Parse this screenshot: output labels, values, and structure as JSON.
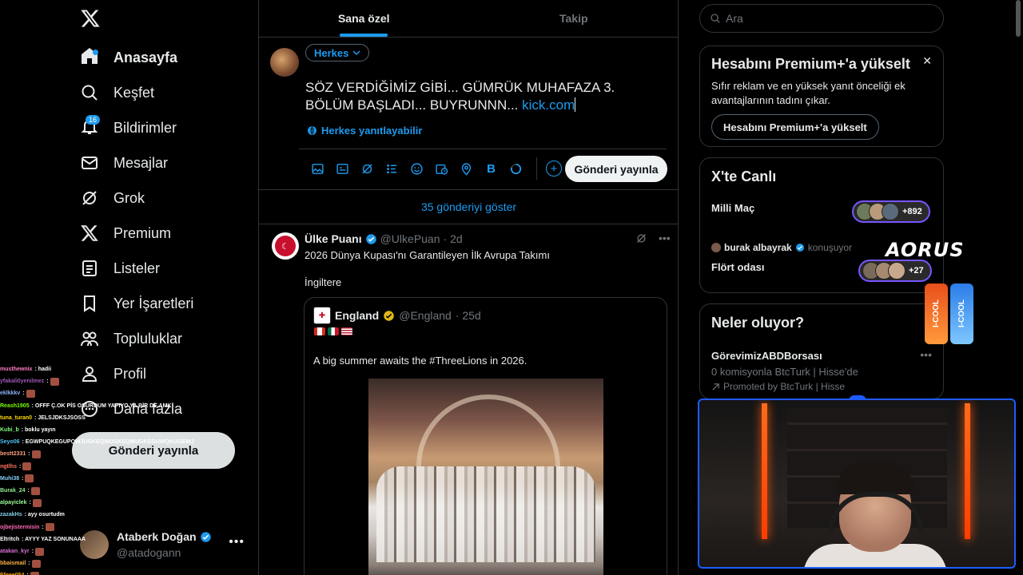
{
  "nav": {
    "items": [
      {
        "label": "Anasayfa",
        "icon": "home-icon"
      },
      {
        "label": "Keşfet",
        "icon": "search-icon"
      },
      {
        "label": "Bildirimler",
        "icon": "bell-icon",
        "badge": "16"
      },
      {
        "label": "Mesajlar",
        "icon": "mail-icon"
      },
      {
        "label": "Grok",
        "icon": "grok-icon"
      },
      {
        "label": "Premium",
        "icon": "x-icon"
      },
      {
        "label": "Listeler",
        "icon": "list-icon"
      },
      {
        "label": "Yer İşaretleri",
        "icon": "bookmark-icon"
      },
      {
        "label": "Topluluklar",
        "icon": "people-icon"
      },
      {
        "label": "Profil",
        "icon": "user-icon"
      },
      {
        "label": "Daha fazla",
        "icon": "more-icon"
      }
    ],
    "post_button": "Gönderi yayınla",
    "account": {
      "name": "Ataberk Doğan",
      "handle": "@atadogann",
      "more": "•••"
    }
  },
  "chat": [
    {
      "user": "musthewnix",
      "msg": ": hadii",
      "color": "#ff7fbf"
    },
    {
      "user": "yfakali0yenilmez",
      "msg": ":",
      "color": "#9b59b6"
    },
    {
      "user": "eklkkkv",
      "msg": ":",
      "color": "#8ab4f8"
    },
    {
      "user": "Reash1905",
      "msg": ": OFFF Ç.OK PİS OSURDUM YAPIYO YA BİR DE AMK",
      "color": "#7cfc00"
    },
    {
      "user": "tuna_turan0",
      "msg": ": JELSJDKSJSOSS",
      "color": "#ffd700"
    },
    {
      "user": "Kubi_b",
      "msg": ": boklu yayın",
      "color": "#7fff7f"
    },
    {
      "user": "Seyo06",
      "msg": ": EGWPUQKEGUPQWJUGKEQWUGKEQWUGKEGUWQKUGEWJ",
      "color": "#4fc3f7"
    },
    {
      "user": "bestt2331",
      "msg": ":",
      "color": "#ffa07a"
    },
    {
      "user": "ngtlhs",
      "msg": ":",
      "color": "#ff6f61"
    },
    {
      "user": "Muhi38",
      "msg": ":",
      "color": "#87cefa"
    },
    {
      "user": "Burak_24",
      "msg": ":",
      "color": "#90ee90"
    },
    {
      "user": "alpayiclek",
      "msg": ":",
      "color": "#98fb98"
    },
    {
      "user": "zazakHs",
      "msg": ": ayy osurtudm",
      "color": "#87ceeb"
    },
    {
      "user": "ojbejistermisin",
      "msg": ":",
      "color": "#ff69b4"
    },
    {
      "user": "Eltritch",
      "msg": ": AYYY YAZ SONUNAAA",
      "color": "#ffffff"
    },
    {
      "user": "atakan_kyr",
      "msg": ":",
      "color": "#da70d6"
    },
    {
      "user": "bbaismail",
      "msg": ":",
      "color": "#ffb347"
    },
    {
      "user": "Efeee054",
      "msg": ":",
      "color": "#ffa500"
    }
  ],
  "tabs": [
    {
      "label": "Sana özel",
      "active": true
    },
    {
      "label": "Takip",
      "active": false
    }
  ],
  "composer": {
    "audience": "Herkes",
    "text": "SÖZ VERDİĞİMİZ GİBİ... GÜMRÜK MUHAFAZA 3. BÖLÜM BAŞLADI... BUYRUNNN... ",
    "link": "kick.com",
    "reply_setting": "Herkes yanıtlayabilir",
    "post_button": "Gönderi yayınla",
    "tools": [
      "image-icon",
      "gif-icon",
      "grok-icon",
      "poll-icon",
      "emoji-icon",
      "schedule-icon",
      "location-icon",
      "bold-icon",
      "progress-ring-icon"
    ]
  },
  "show_more": "35 gönderiyi göster",
  "tweet": {
    "name": "Ülke Puanı",
    "handle": "@UlkePuan",
    "time": "· 2d",
    "text1": "2026 Dünya Kupası'nı Garantileyen İlk Avrupa Takımı",
    "text2": "İngiltere",
    "quote": {
      "name": "England",
      "handle": "@England",
      "time": "· 25d",
      "text": "A big summer awaits the #ThreeLions in 2026."
    }
  },
  "search": {
    "placeholder": "Ara"
  },
  "premium_card": {
    "title": "Hesabını Premium+'a yükselt",
    "body": "Sıfır reklam ve en yüksek yanıt önceliği ek avantajlarının tadını çıkar.",
    "button": "Hesabını Premium+'a yükselt"
  },
  "live_card": {
    "title": "X'te Canlı",
    "space1": {
      "title": "Milli Maç",
      "count": "+892"
    },
    "host": {
      "name": "burak albayrak",
      "status": "konuşuyor"
    },
    "space2": {
      "title": "Flört odası",
      "count": "+27"
    }
  },
  "trends_card": {
    "title": "Neler oluyor?",
    "trend": "GörevimizABDBorsası",
    "desc": "0 komisyonla BtcTurk | Hisse'de",
    "promo": "Promoted by BtcTurk | Hisse"
  },
  "overlay": {
    "sponsor": "AORUS",
    "can1": "I-COOL",
    "can2": "I-COOL"
  },
  "colors": {
    "accent": "#1d9bf0",
    "border": "#2f3336",
    "muted": "#71767b"
  }
}
